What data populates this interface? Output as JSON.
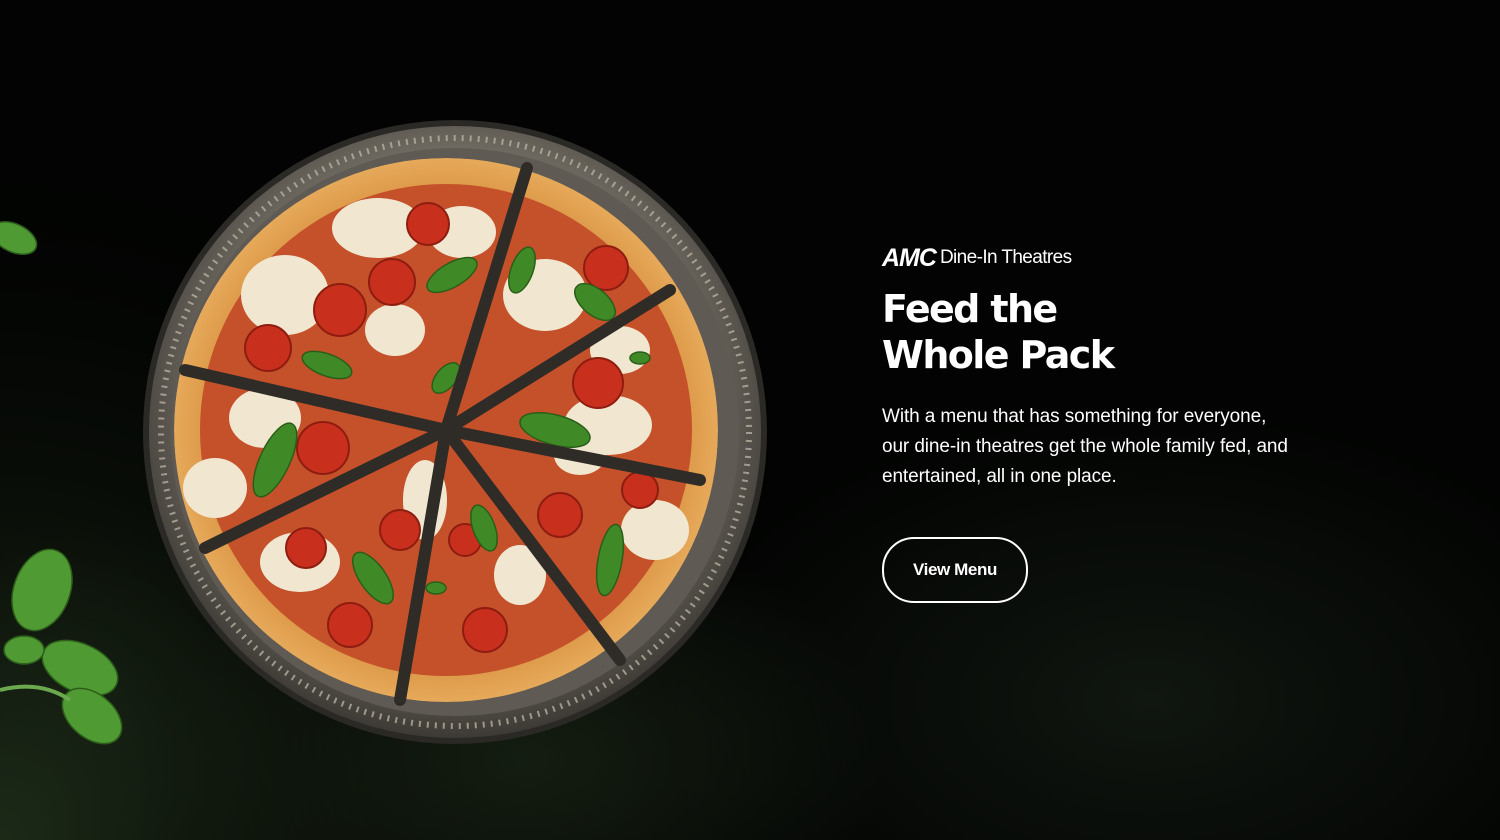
{
  "brand": {
    "logo_text": "AMC",
    "subtitle": "Dine-In Theatres"
  },
  "hero": {
    "headline_line1": "Feed the",
    "headline_line2": "Whole Pack",
    "body": "With a menu that has something for everyone, our dine-in theatres get the whole family fed, and entertained, all in one place.",
    "cta_label": "View Menu"
  },
  "image": {
    "subject": "pizza-icon",
    "colors": {
      "background": "#000000",
      "tray": "#7a756c",
      "crust": "#d9953f",
      "cheese": "#f3ead6",
      "sauce": "#b8321d",
      "tomato": "#c62d1b",
      "basil": "#3f8a26"
    }
  }
}
